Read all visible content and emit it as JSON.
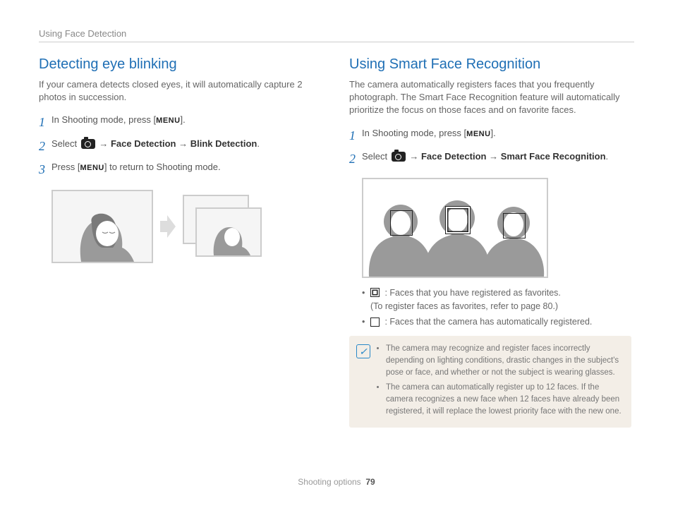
{
  "header": "Using Face Detection",
  "footer": {
    "section": "Shooting options",
    "page": "79"
  },
  "left": {
    "title": "Detecting eye blinking",
    "intro": "If your camera detects closed eyes, it will automatically capture 2 photos in succession.",
    "steps": {
      "s1": {
        "n": "1",
        "a": "In Shooting mode, press [",
        "menu": "MENU",
        "b": "]."
      },
      "s2": {
        "n": "2",
        "a": "Select ",
        "arrow1": " → ",
        "fd": "Face Detection",
        "arrow2": " → ",
        "opt": "Blink Detection",
        "b": "."
      },
      "s3": {
        "n": "3",
        "a": "Press [",
        "menu": "MENU",
        "b": "] to return to Shooting mode."
      }
    }
  },
  "right": {
    "title": "Using Smart Face Recognition",
    "intro": "The camera automatically registers faces that you frequently photograph. The Smart Face Recognition feature will automatically prioritize the focus on those faces and on favorite faces.",
    "steps": {
      "s1": {
        "n": "1",
        "a": "In Shooting mode, press [",
        "menu": "MENU",
        "b": "]."
      },
      "s2": {
        "n": "2",
        "a": "Select ",
        "arrow1": " → ",
        "fd": "Face Detection",
        "arrow2": " → ",
        "opt": "Smart Face Recognition",
        "b": "."
      }
    },
    "legend": {
      "fav_a": " : Faces that you have registered as favorites.",
      "fav_b": "(To register faces as favorites, refer to page 80.)",
      "auto": " : Faces that the camera has automatically registered."
    },
    "notes": {
      "n1": "The camera may recognize and register faces incorrectly depending on lighting conditions, drastic changes in the subject's pose or face, and whether or not the subject is wearing glasses.",
      "n2": "The camera can automatically register up to 12 faces. If the camera recognizes a new face when 12 faces have already been registered, it will replace the lowest priority face with the new one."
    }
  }
}
